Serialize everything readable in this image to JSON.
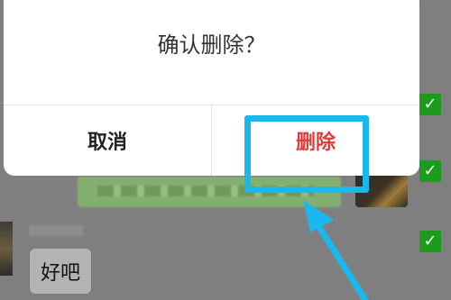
{
  "dialog": {
    "message": "确认删除？",
    "cancel_label": "取消",
    "delete_label": "删除"
  },
  "chat": {
    "received_message": "好吧"
  },
  "colors": {
    "highlight": "#1ab8ec",
    "delete_text": "#e53935",
    "checkbox": "#1c9b1c"
  }
}
